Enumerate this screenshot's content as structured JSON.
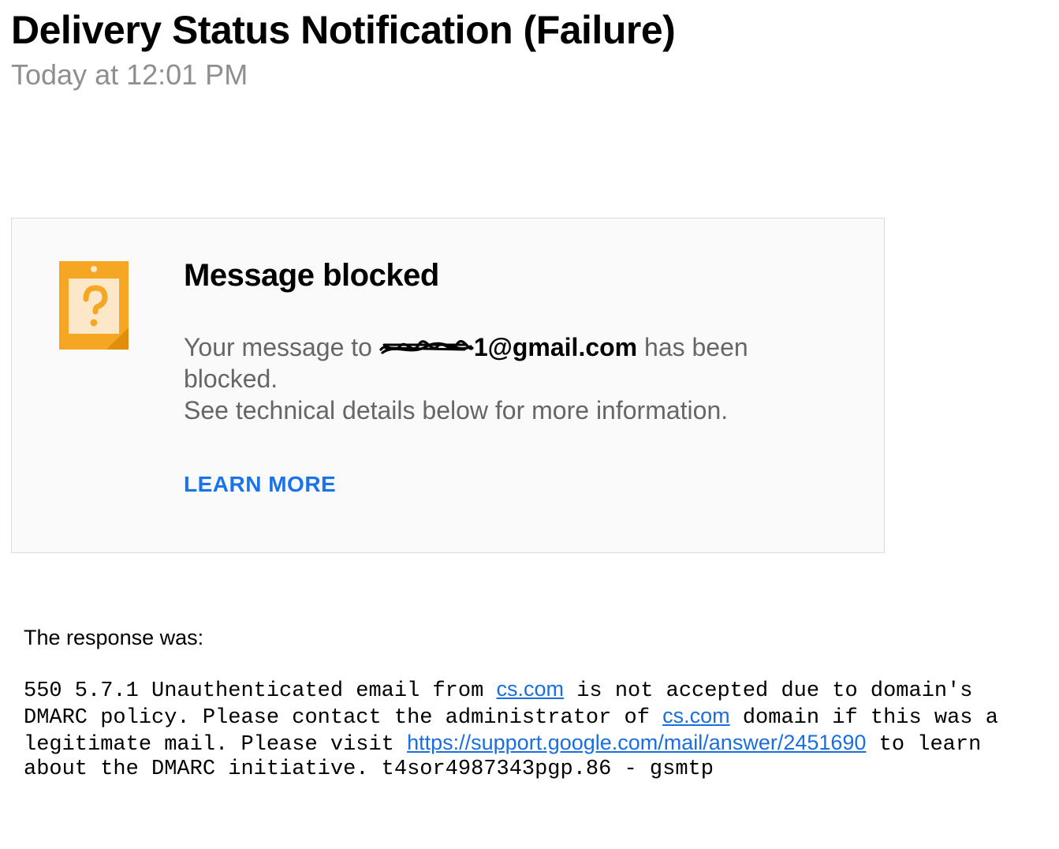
{
  "header": {
    "subject": "Delivery Status Notification (Failure)",
    "timestamp": "Today at 12:01 PM"
  },
  "card": {
    "title": "Message blocked",
    "line_prefix": "Your message to ",
    "address_visible_suffix": "1@gmail.com",
    "line_middle": " has been blocked.",
    "line2": "See technical details below for more information.",
    "learn_more": "LEARN MORE"
  },
  "details": {
    "intro": "The response was:",
    "seg1": "550 5.7.1 Unauthenticated email from ",
    "link1_text": "cs.com",
    "seg2": " is not accepted due to domain's DMARC policy. Please contact the administrator of ",
    "link2_text": "cs.com",
    "seg3": " domain if this was a legitimate mail. Please visit ",
    "link3_text": "https://support.google.com/mail/answer/2451690",
    "seg4": " to learn about the DMARC initiative. t4sor4987343pgp.86 - gsmtp"
  }
}
